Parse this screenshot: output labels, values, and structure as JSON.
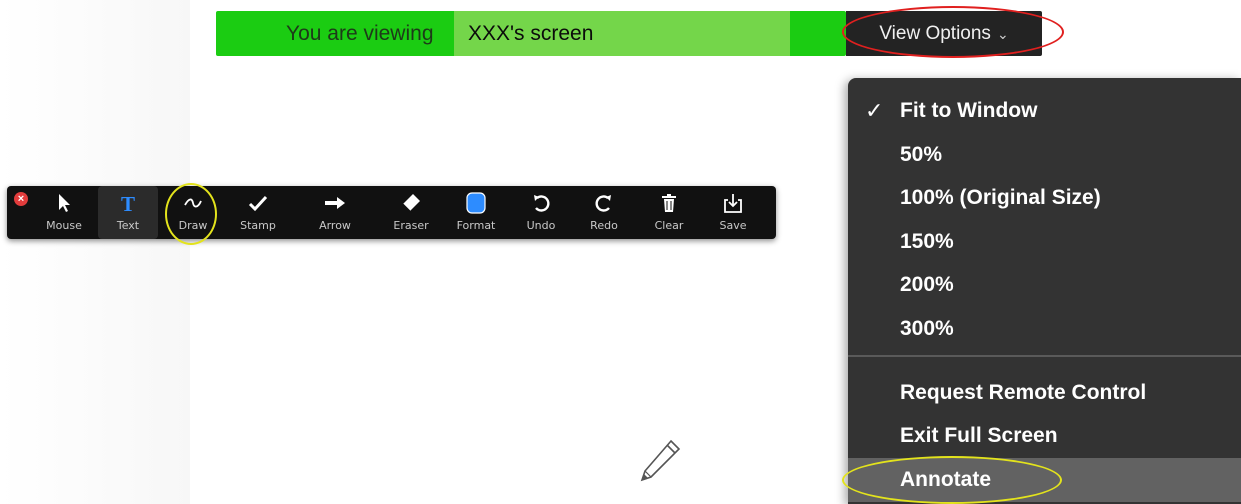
{
  "banner": {
    "prefix": "You are viewing",
    "screen_name": "XXX's screen",
    "view_options_label": "View Options",
    "bg_color": "#1bcc12"
  },
  "toolbar": {
    "close_icon": "close-icon",
    "tools": [
      {
        "label": "Mouse",
        "icon": "mouse-pointer-icon"
      },
      {
        "label": "Text",
        "icon": "text-icon"
      },
      {
        "label": "Draw",
        "icon": "draw-icon"
      },
      {
        "label": "Stamp",
        "icon": "stamp-icon"
      },
      {
        "label": "Arrow",
        "icon": "arrow-icon"
      },
      {
        "label": "Eraser",
        "icon": "eraser-icon"
      },
      {
        "label": "Format",
        "icon": "format-icon"
      },
      {
        "label": "Undo",
        "icon": "undo-icon"
      },
      {
        "label": "Redo",
        "icon": "redo-icon"
      },
      {
        "label": "Clear",
        "icon": "trash-icon"
      },
      {
        "label": "Save",
        "icon": "save-icon"
      }
    ],
    "accent_color": "#2d8cff"
  },
  "menu": {
    "items": [
      {
        "label": "Fit to Window",
        "checked": true
      },
      {
        "label": "50%"
      },
      {
        "label": "100% (Original Size)"
      },
      {
        "label": "150%"
      },
      {
        "label": "200%"
      },
      {
        "label": "300%"
      },
      {
        "label": "Request Remote Control"
      },
      {
        "label": "Exit Full Screen"
      },
      {
        "label": "Annotate",
        "highlighted": true
      }
    ]
  },
  "cursor": {
    "icon": "pencil-icon"
  }
}
